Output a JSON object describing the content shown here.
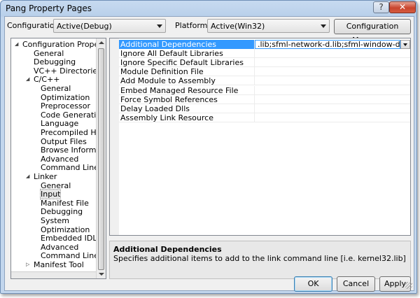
{
  "window": {
    "title": "Pang Property Pages",
    "caption_buttons": {
      "help_icon": "?",
      "close_icon": "✕"
    }
  },
  "toolbar": {
    "configuration_label": "Configuration:",
    "configuration_value": "Active(Debug)",
    "platform_label": "Platform:",
    "platform_value": "Active(Win32)",
    "configuration_manager_label": "Configuration Manager..."
  },
  "tree": {
    "items": [
      {
        "label": "Configuration Properties",
        "toggle": "◢"
      },
      {
        "label": "General"
      },
      {
        "label": "Debugging"
      },
      {
        "label": "VC++ Directories"
      },
      {
        "label": "C/C++",
        "toggle": "◢"
      },
      {
        "label": "General"
      },
      {
        "label": "Optimization"
      },
      {
        "label": "Preprocessor"
      },
      {
        "label": "Code Generation"
      },
      {
        "label": "Language"
      },
      {
        "label": "Precompiled Heade"
      },
      {
        "label": "Output Files"
      },
      {
        "label": "Browse Information"
      },
      {
        "label": "Advanced"
      },
      {
        "label": "Command Line"
      },
      {
        "label": "Linker",
        "toggle": "◢"
      },
      {
        "label": "General"
      },
      {
        "label": "Input",
        "selected": true
      },
      {
        "label": "Manifest File"
      },
      {
        "label": "Debugging"
      },
      {
        "label": "System"
      },
      {
        "label": "Optimization"
      },
      {
        "label": "Embedded IDL"
      },
      {
        "label": "Advanced"
      },
      {
        "label": "Command Line"
      },
      {
        "label": "Manifest Tool",
        "toggle": "▷"
      }
    ]
  },
  "properties": {
    "rows": [
      {
        "name": "Additional Dependencies",
        "value": ".lib;sfml-network-d.lib;sfml-window-d.lib;%(AdditionalD",
        "selected": true
      },
      {
        "name": "Ignore All Default Libraries",
        "value": ""
      },
      {
        "name": "Ignore Specific Default Libraries",
        "value": ""
      },
      {
        "name": "Module Definition File",
        "value": ""
      },
      {
        "name": "Add Module to Assembly",
        "value": ""
      },
      {
        "name": "Embed Managed Resource File",
        "value": ""
      },
      {
        "name": "Force Symbol References",
        "value": ""
      },
      {
        "name": "Delay Loaded Dlls",
        "value": ""
      },
      {
        "name": "Assembly Link Resource",
        "value": ""
      }
    ]
  },
  "description": {
    "title": "Additional Dependencies",
    "text": "Specifies additional items to add to the link command line [i.e. kernel32.lib]"
  },
  "buttons": {
    "ok": "OK",
    "cancel": "Cancel",
    "apply": "Apply"
  },
  "colors": {
    "selection": "#3399ff",
    "title_gradient": "#c7daf0"
  }
}
